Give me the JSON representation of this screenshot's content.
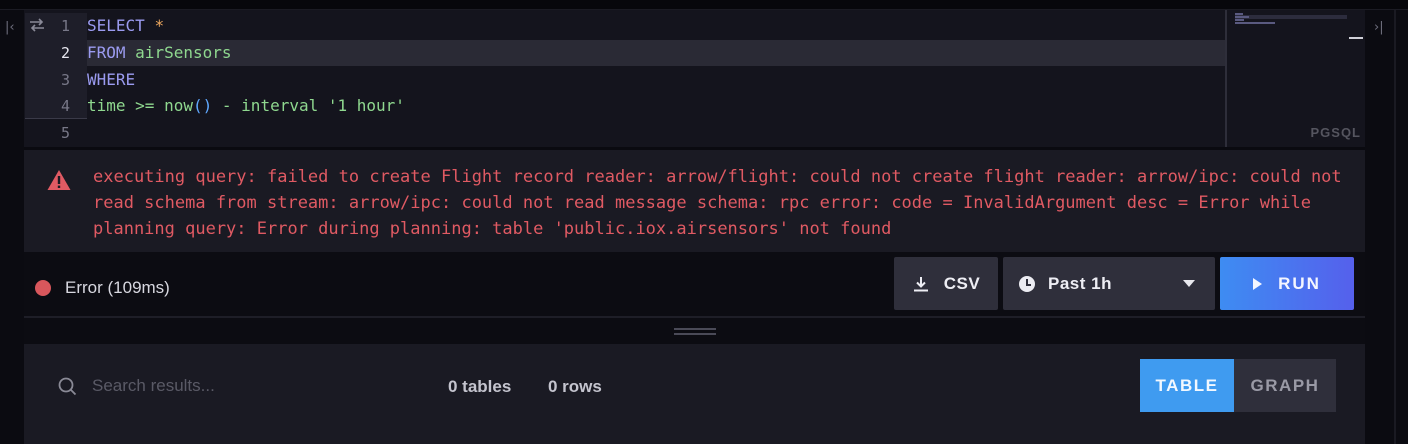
{
  "editor": {
    "language": "PGSQL",
    "active_line": 2,
    "line_numbers": [
      "1",
      "2",
      "3",
      "4",
      "5"
    ],
    "lines": [
      [
        {
          "t": "SELECT",
          "c": "kw"
        },
        {
          "t": " ",
          "c": ""
        },
        {
          "t": "*",
          "c": "op"
        }
      ],
      [
        {
          "t": "FROM",
          "c": "kw"
        },
        {
          "t": " ",
          "c": ""
        },
        {
          "t": "airSensors",
          "c": "id"
        }
      ],
      [
        {
          "t": "WHERE",
          "c": "kw"
        }
      ],
      [
        {
          "t": "time",
          "c": "id"
        },
        {
          "t": " ",
          "c": ""
        },
        {
          "t": ">=",
          "c": "id"
        },
        {
          "t": " ",
          "c": ""
        },
        {
          "t": "now",
          "c": "id"
        },
        {
          "t": "()",
          "c": "paren"
        },
        {
          "t": " ",
          "c": ""
        },
        {
          "t": "-",
          "c": "id"
        },
        {
          "t": " ",
          "c": ""
        },
        {
          "t": "interval",
          "c": "id"
        },
        {
          "t": " ",
          "c": ""
        },
        {
          "t": "'1 hour'",
          "c": "id"
        }
      ],
      []
    ]
  },
  "error": {
    "message": "executing query: failed to create Flight record reader: arrow/flight: could not create flight reader: arrow/ipc: could not read schema from stream: arrow/ipc: could not read message schema: rpc error: code = InvalidArgument desc = Error while planning query: Error during planning: table 'public.iox.airsensors' not found",
    "color": "#e05a63"
  },
  "actions": {
    "status_text": "Error (109ms)",
    "status_color": "#d8575c",
    "csv_label": "CSV",
    "time_range": "Past 1h",
    "run_label": "RUN"
  },
  "results": {
    "search_placeholder": "Search results...",
    "tables_count": "0 tables",
    "rows_count": "0 rows",
    "view_table": "TABLE",
    "view_graph": "GRAPH",
    "selected_view": "TABLE"
  },
  "colors": {
    "accent": "#3f9bf0",
    "run_gradient_start": "#3e8cf2",
    "run_gradient_end": "#5560ec"
  }
}
